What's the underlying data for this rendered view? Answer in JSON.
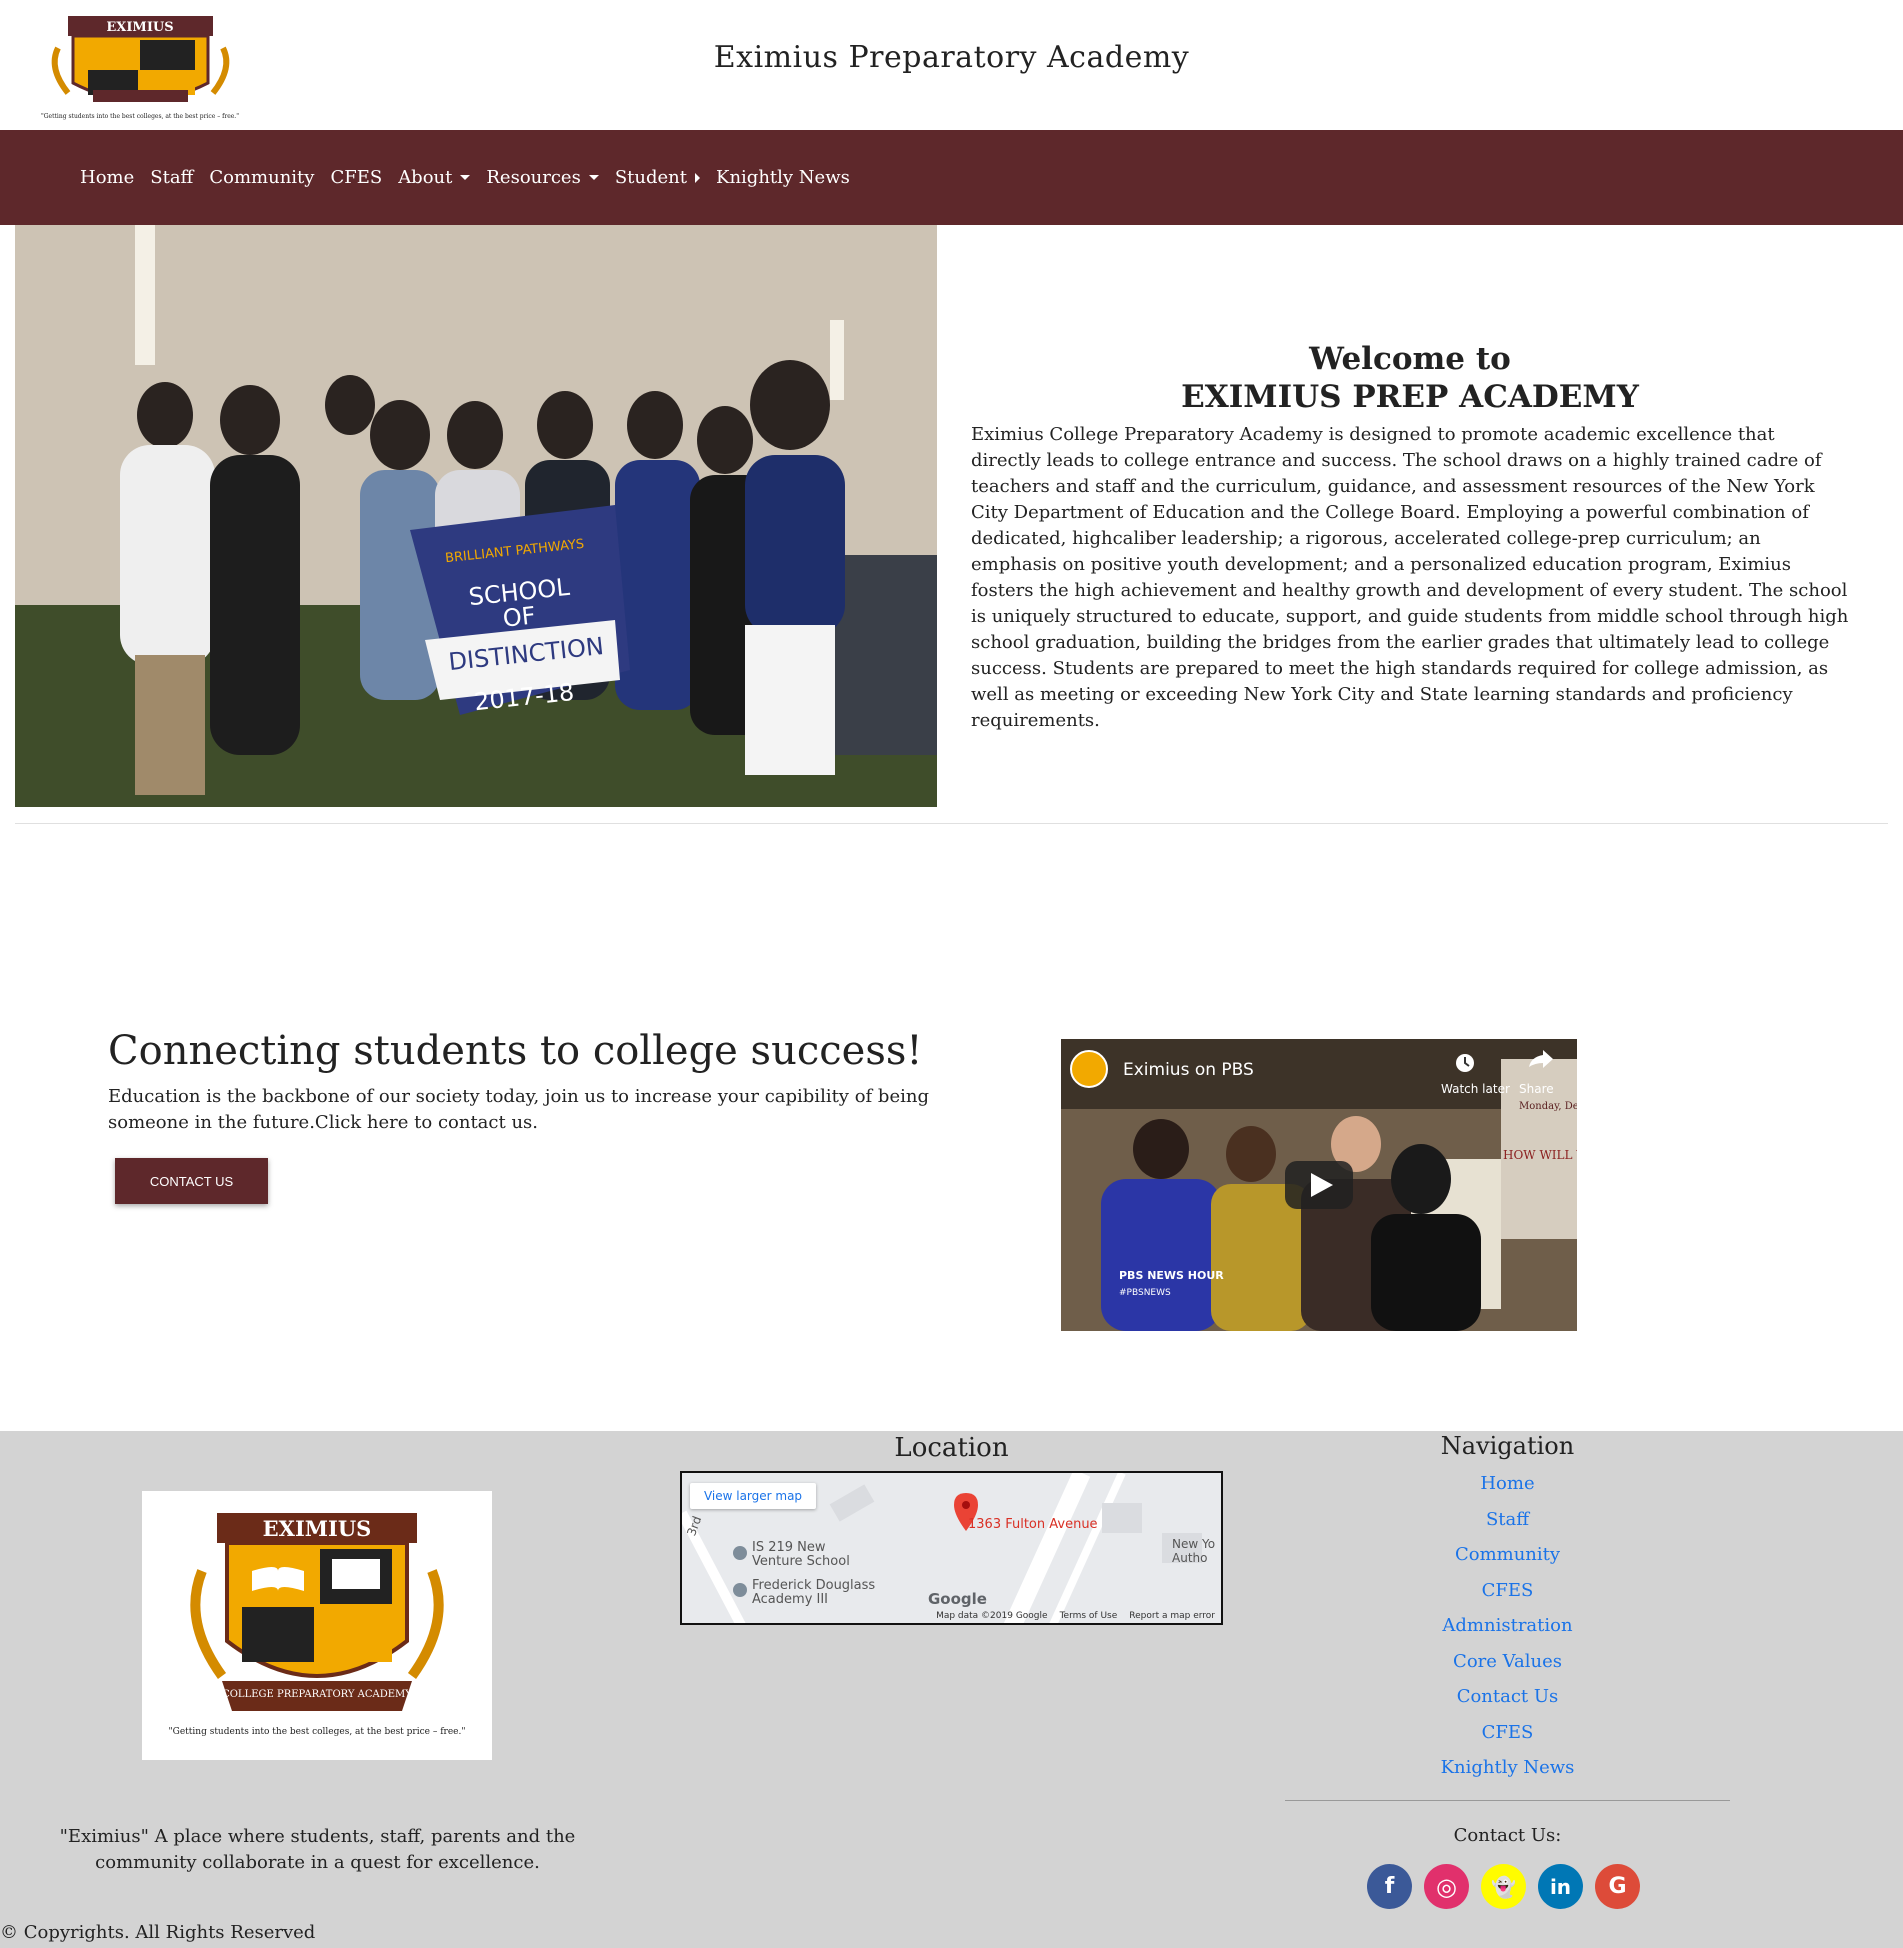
{
  "header": {
    "title": "Eximius Preparatory Academy",
    "logo_top_text": "EXIMIUS",
    "logo_bottom_text": "COLLEGE PREPARATORY ACADEMY",
    "logo_tagline": "\"Getting students into the best colleges, at the best price – free.\""
  },
  "nav": {
    "items": [
      {
        "label": "Home"
      },
      {
        "label": "Staff"
      },
      {
        "label": "Community"
      },
      {
        "label": "CFES"
      },
      {
        "label": "About"
      },
      {
        "label": "Resources"
      },
      {
        "label": "Student"
      },
      {
        "label": "Knightly News"
      }
    ]
  },
  "hero": {
    "banner_line1": "BRILLIANT PATHWAYS",
    "banner_line2": "SCHOOL",
    "banner_line3": "OF",
    "banner_line4": "DISTINCTION",
    "banner_year": "2017-18",
    "welcome_line1": "Welcome to",
    "welcome_line2": "EXIMIUS PREP ACADEMY",
    "body": "Eximius College Preparatory Academy is designed to promote academic excellence that directly leads to college entrance and success. The school draws on a highly trained cadre of teachers and staff and the curriculum, guidance, and assessment resources of the New York City Department of Education and the College Board. Employing a powerful combination of dedicated, highcaliber leadership; a rigorous, accelerated college-prep curriculum; an emphasis on positive youth development; and a personalized education program, Eximius fosters the high achievement and healthy growth and development of every student. The school is uniquely structured to educate, support, and guide students from middle school through high school graduation, building the bridges from the earlier grades that ultimately lead to college success. Students are prepared to meet the high standards required for college admission, as well as meeting or exceeding New York City and State learning standards and proficiency requirements."
  },
  "connect": {
    "heading": "Connecting students to college success!",
    "body": "Education is the backbone of our society today, join us to increase your capibility of being someone in the future.Click here to contact us.",
    "button": "CONTACT US"
  },
  "video": {
    "title": "Eximius on PBS",
    "watch_later": "Watch later",
    "share": "Share",
    "channel_badge": "PBS NEWS HOUR",
    "channel_handle": "#PBSNEWS",
    "board_text": "HOW WILL YO",
    "board_day": "Monday, December"
  },
  "footer": {
    "tagline": "\"Eximius\" A place where students, staff, parents and the community collaborate in a quest for excellence.",
    "copyright": "© Copyrights. All Rights Reserved",
    "location_title": "Location",
    "map": {
      "view_larger": "View larger map",
      "pin_label": "1363 Fulton Avenue",
      "poi1": "IS 219 New Venture School",
      "poi2": "Frederick Douglass Academy III",
      "street": "3rd",
      "edge_label": "New Yo Autho",
      "google": "Google",
      "map_data": "Map data ©2019 Google",
      "terms": "Terms of Use",
      "report": "Report a map error"
    },
    "navigation_title": "Navigation",
    "nav_links": [
      {
        "label": "Home"
      },
      {
        "label": "Staff"
      },
      {
        "label": "Community"
      },
      {
        "label": "CFES"
      },
      {
        "label": "Admnistration"
      },
      {
        "label": "Core Values"
      },
      {
        "label": "Contact Us"
      },
      {
        "label": "CFES"
      },
      {
        "label": "Knightly News"
      }
    ],
    "contact_label": "Contact Us:",
    "socials": [
      {
        "name": "facebook-icon",
        "glyph": "f",
        "color": "#3b5998"
      },
      {
        "name": "instagram-icon",
        "glyph": "◎",
        "color": "#e1306c"
      },
      {
        "name": "snapchat-icon",
        "glyph": "👻",
        "color": "#fffc00"
      },
      {
        "name": "linkedin-icon",
        "glyph": "in",
        "color": "#0077b5"
      },
      {
        "name": "google-icon",
        "glyph": "G",
        "color": "#dd4b39"
      }
    ]
  },
  "colors": {
    "nav_bg": "#5e282b",
    "footer_bg": "#d3d3d3",
    "link": "#1a73e8"
  }
}
